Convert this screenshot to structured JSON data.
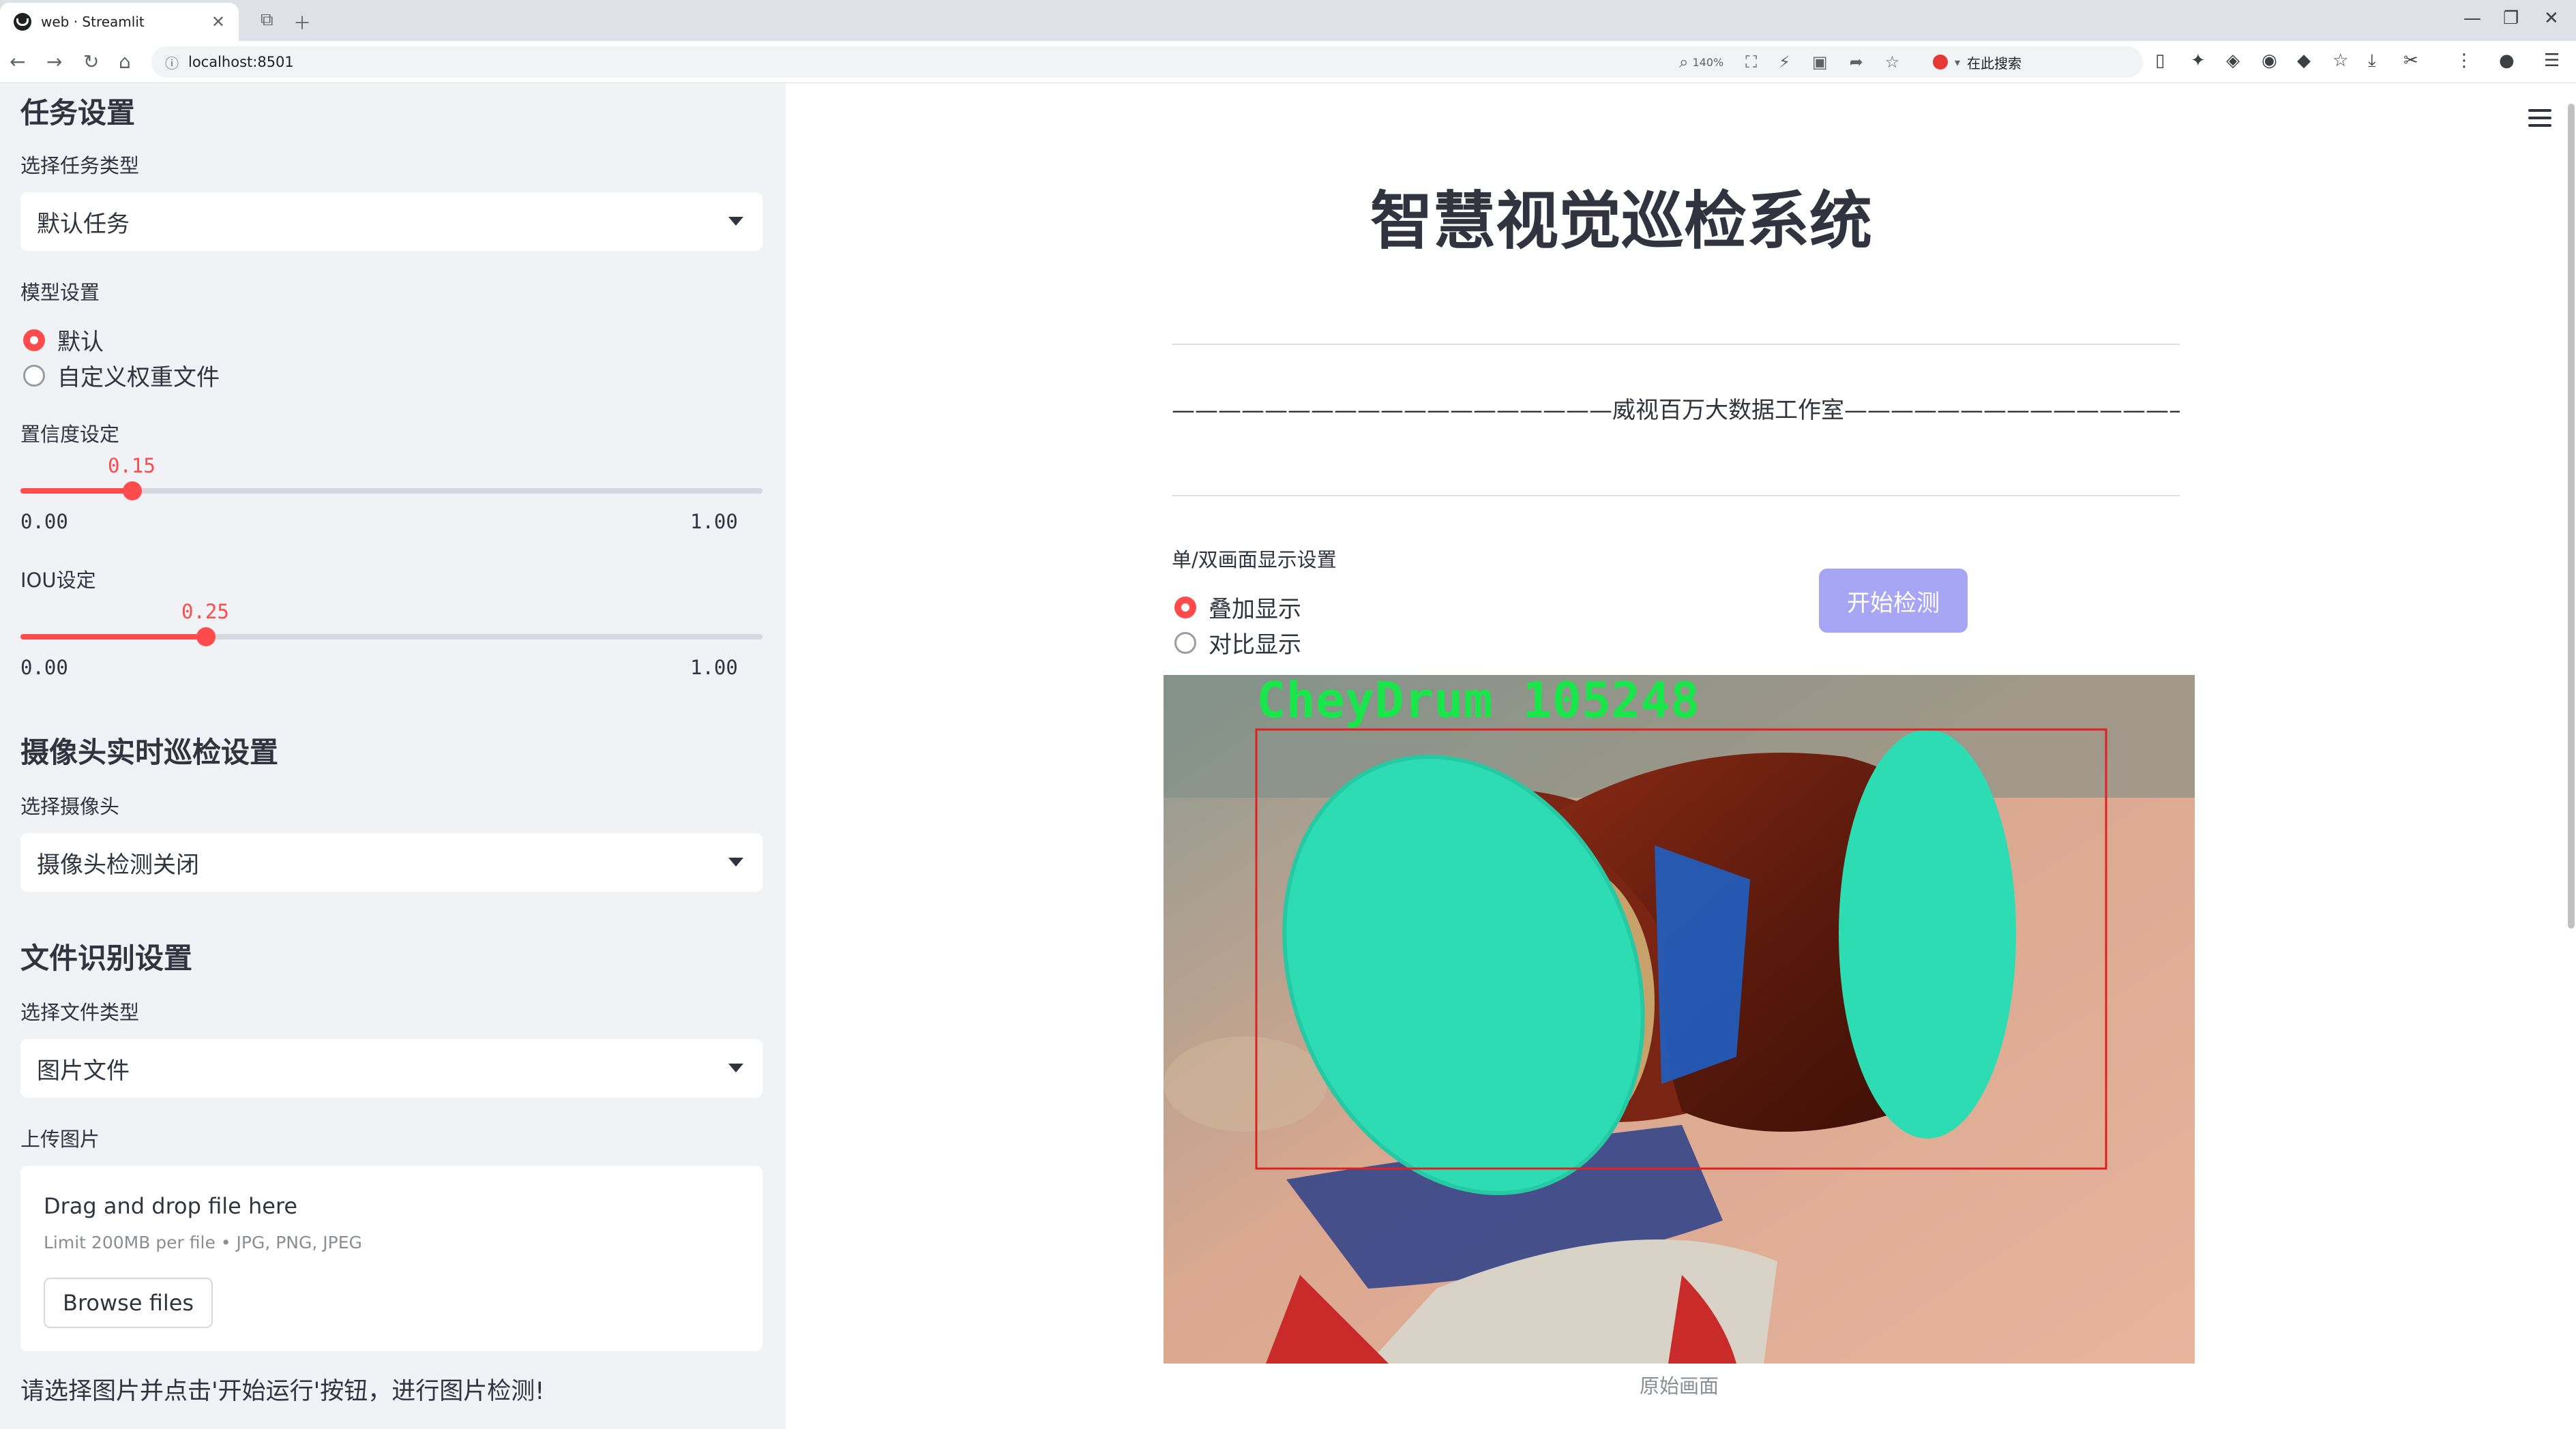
{
  "browser": {
    "tab_title": "web · Streamlit",
    "url": "localhost:8501",
    "zoom": "140%",
    "search_placeholder": "在此搜索"
  },
  "sidebar": {
    "task_section_title": "任务设置",
    "task_type_label": "选择任务类型",
    "task_type_value": "默认任务",
    "model_label": "模型设置",
    "model_options": [
      "默认",
      "自定义权重文件"
    ],
    "model_selected": "默认",
    "conf_label": "置信度设定",
    "conf_value": "0.15",
    "conf_min": "0.00",
    "conf_max": "1.00",
    "iou_label": "IOU设定",
    "iou_value": "0.25",
    "iou_min": "0.00",
    "iou_max": "1.00",
    "camera_section_title": "摄像头实时巡检设置",
    "camera_label": "选择摄像头",
    "camera_value": "摄像头检测关闭",
    "file_section_title": "文件识别设置",
    "file_type_label": "选择文件类型",
    "file_type_value": "图片文件",
    "upload_label": "上传图片",
    "upload_title": "Drag and drop file here",
    "upload_limit": "Limit 200MB per file • JPG, PNG, JPEG",
    "browse_button": "Browse files",
    "footer_hint": "请选择图片并点击'开始运行'按钮，进行图片检测!"
  },
  "main": {
    "title": "智慧视觉巡检系统",
    "subtitle": "———————————————————威视百万大数据工作室————————————————————",
    "display_label": "单/双画面显示设置",
    "display_options": [
      "叠加显示",
      "对比显示"
    ],
    "display_selected": "叠加显示",
    "start_button": "开始检测",
    "detection_label": "CheyDrum  105248",
    "image_caption": "原始画面"
  },
  "colors": {
    "accent": "#ff4b4b",
    "start_button": "#a7a6f5",
    "detection_box": "#e02020",
    "detection_text": "#19e64a"
  }
}
